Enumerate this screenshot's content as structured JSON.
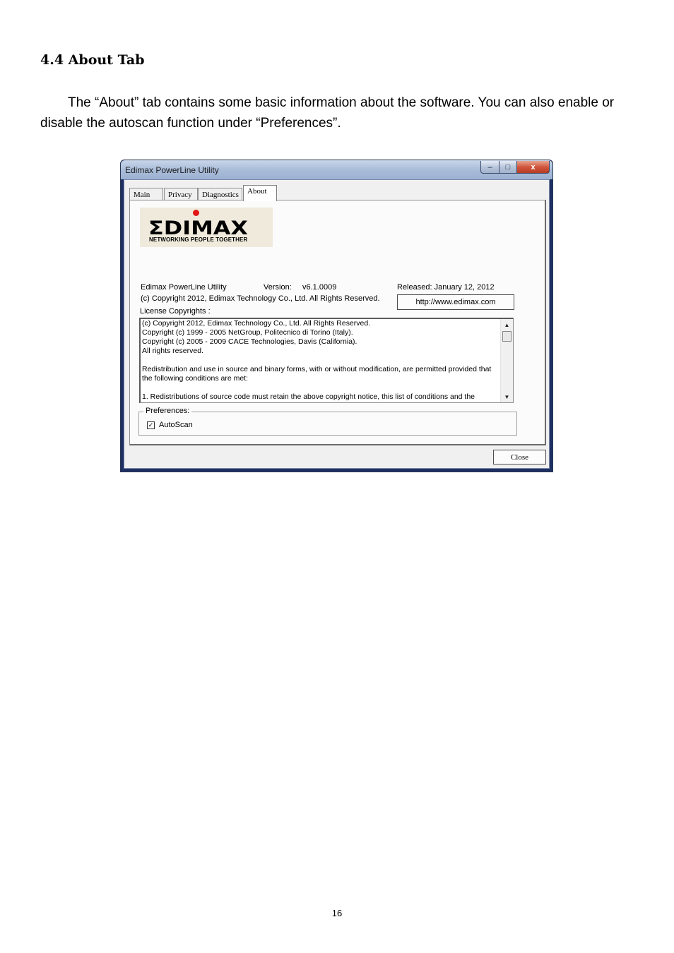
{
  "document": {
    "heading": "4.4 About Tab",
    "paragraph": "The “About” tab contains some basic information about the software. You can also enable or disable the autoscan function under “Preferences”.",
    "page_number": "16"
  },
  "window": {
    "title": "Edimax PowerLine Utility",
    "controls": {
      "minimize": "–",
      "maximize": "□",
      "close": "x"
    },
    "tabs": [
      {
        "label": "Main"
      },
      {
        "label": "Privacy"
      },
      {
        "label": "Diagnostics"
      },
      {
        "label": "About",
        "active": true
      }
    ],
    "logo": {
      "word": "ΣDIMAX",
      "tagline": "NETWORKING PEOPLE TOGETHER",
      "dot_color": "#e01818"
    },
    "about": {
      "product_name": "Edimax PowerLine Utility",
      "version_label": "Version:",
      "version": "v6.1.0009",
      "released": "Released: January 12, 2012",
      "copyright": "(c) Copyright 2012, Edimax Technology Co., Ltd. All Rights Reserved.",
      "url_button": "http://www.edimax.com",
      "license_label": "License Copyrights :"
    },
    "license_lines": [
      "(c) Copyright 2012, Edimax Technology Co., Ltd. All Rights Reserved.",
      "Copyright (c) 1999 - 2005 NetGroup, Politecnico di Torino (Italy).",
      "Copyright (c) 2005 - 2009 CACE Technologies, Davis (California).",
      "All rights reserved.",
      "",
      "Redistribution and use in source and binary forms, with or without modification, are permitted provided that",
      "the following conditions are met:",
      "",
      "1. Redistributions of source code must retain the above copyright notice, this list of conditions and the"
    ],
    "preferences": {
      "legend": "Preferences:",
      "autoscan_label": "AutoScan",
      "autoscan_checked": true,
      "check_mark": "✓"
    },
    "close_button": "Close"
  }
}
